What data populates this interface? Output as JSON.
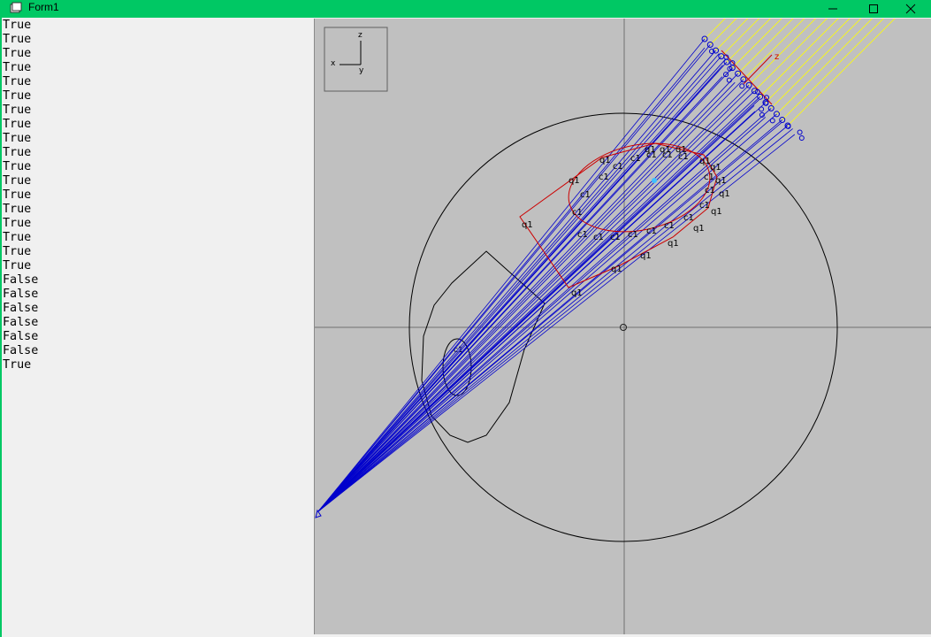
{
  "window": {
    "title": "Form1",
    "accent_color": "#00c864"
  },
  "list": {
    "items": [
      "True",
      "True",
      "True",
      "True",
      "True",
      "True",
      "True",
      "True",
      "True",
      "True",
      "True",
      "True",
      "True",
      "True",
      "True",
      "True",
      "True",
      "True",
      "False",
      "False",
      "False",
      "False",
      "False",
      "False",
      "True"
    ]
  },
  "viewport": {
    "background": "#c0c0c0",
    "axis_gizmo": {
      "z_label": "z",
      "x_label": "x",
      "y_label": "y"
    },
    "source_z_label": "z",
    "point_label": "q1",
    "curve_label": "c1",
    "dark_label": "c1",
    "ray_color": "#0000cc",
    "incoming_ray_color": "#ffff00",
    "ellipse_color": "#cc0000"
  }
}
